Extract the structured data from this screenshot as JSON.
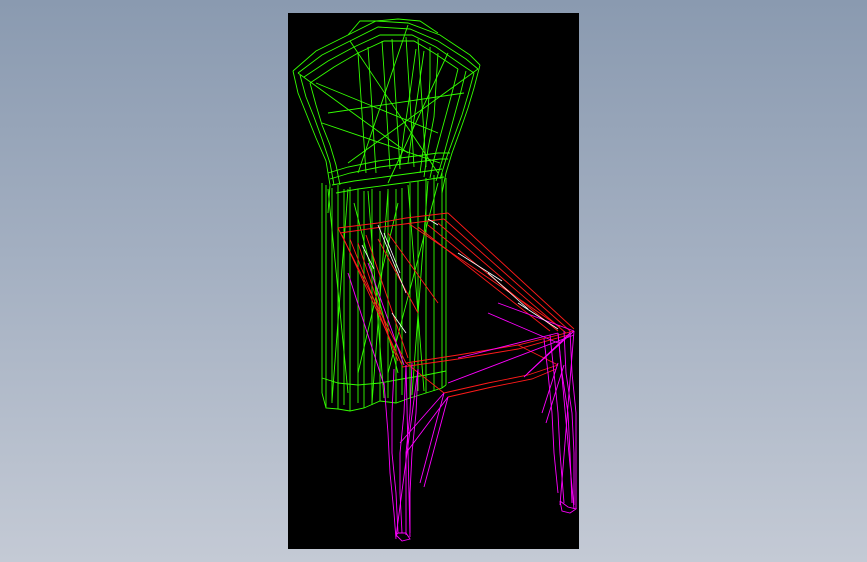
{
  "model": {
    "type": "wireframe-chair",
    "colors": {
      "background": "#000000",
      "backrest": "#33ff00",
      "seat_frame": "#ff1a1a",
      "legs": "#ff00ff",
      "highlight": "#ffffff"
    },
    "parts": [
      "backrest",
      "seat-frame",
      "front-legs",
      "highlight-edges"
    ]
  }
}
